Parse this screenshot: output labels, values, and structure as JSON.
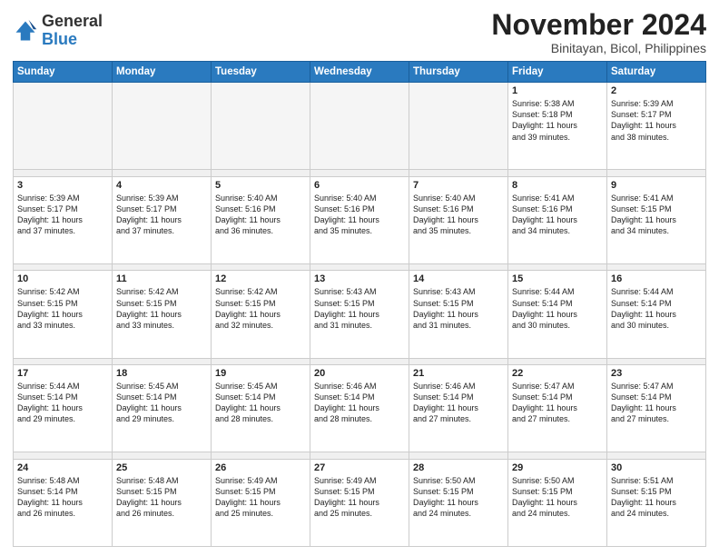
{
  "header": {
    "logo_general": "General",
    "logo_blue": "Blue",
    "month_title": "November 2024",
    "subtitle": "Binitayan, Bicol, Philippines"
  },
  "calendar": {
    "days_of_week": [
      "Sunday",
      "Monday",
      "Tuesday",
      "Wednesday",
      "Thursday",
      "Friday",
      "Saturday"
    ],
    "weeks": [
      {
        "days": [
          {
            "num": "",
            "content": ""
          },
          {
            "num": "",
            "content": ""
          },
          {
            "num": "",
            "content": ""
          },
          {
            "num": "",
            "content": ""
          },
          {
            "num": "",
            "content": ""
          },
          {
            "num": "1",
            "content": "Sunrise: 5:38 AM\nSunset: 5:18 PM\nDaylight: 11 hours and 39 minutes."
          },
          {
            "num": "2",
            "content": "Sunrise: 5:39 AM\nSunset: 5:17 PM\nDaylight: 11 hours and 38 minutes."
          }
        ]
      },
      {
        "days": [
          {
            "num": "3",
            "content": "Sunrise: 5:39 AM\nSunset: 5:17 PM\nDaylight: 11 hours and 37 minutes."
          },
          {
            "num": "4",
            "content": "Sunrise: 5:39 AM\nSunset: 5:17 PM\nDaylight: 11 hours and 37 minutes."
          },
          {
            "num": "5",
            "content": "Sunrise: 5:40 AM\nSunset: 5:16 PM\nDaylight: 11 hours and 36 minutes."
          },
          {
            "num": "6",
            "content": "Sunrise: 5:40 AM\nSunset: 5:16 PM\nDaylight: 11 hours and 35 minutes."
          },
          {
            "num": "7",
            "content": "Sunrise: 5:40 AM\nSunset: 5:16 PM\nDaylight: 11 hours and 35 minutes."
          },
          {
            "num": "8",
            "content": "Sunrise: 5:41 AM\nSunset: 5:16 PM\nDaylight: 11 hours and 34 minutes."
          },
          {
            "num": "9",
            "content": "Sunrise: 5:41 AM\nSunset: 5:15 PM\nDaylight: 11 hours and 34 minutes."
          }
        ]
      },
      {
        "days": [
          {
            "num": "10",
            "content": "Sunrise: 5:42 AM\nSunset: 5:15 PM\nDaylight: 11 hours and 33 minutes."
          },
          {
            "num": "11",
            "content": "Sunrise: 5:42 AM\nSunset: 5:15 PM\nDaylight: 11 hours and 33 minutes."
          },
          {
            "num": "12",
            "content": "Sunrise: 5:42 AM\nSunset: 5:15 PM\nDaylight: 11 hours and 32 minutes."
          },
          {
            "num": "13",
            "content": "Sunrise: 5:43 AM\nSunset: 5:15 PM\nDaylight: 11 hours and 31 minutes."
          },
          {
            "num": "14",
            "content": "Sunrise: 5:43 AM\nSunset: 5:15 PM\nDaylight: 11 hours and 31 minutes."
          },
          {
            "num": "15",
            "content": "Sunrise: 5:44 AM\nSunset: 5:14 PM\nDaylight: 11 hours and 30 minutes."
          },
          {
            "num": "16",
            "content": "Sunrise: 5:44 AM\nSunset: 5:14 PM\nDaylight: 11 hours and 30 minutes."
          }
        ]
      },
      {
        "days": [
          {
            "num": "17",
            "content": "Sunrise: 5:44 AM\nSunset: 5:14 PM\nDaylight: 11 hours and 29 minutes."
          },
          {
            "num": "18",
            "content": "Sunrise: 5:45 AM\nSunset: 5:14 PM\nDaylight: 11 hours and 29 minutes."
          },
          {
            "num": "19",
            "content": "Sunrise: 5:45 AM\nSunset: 5:14 PM\nDaylight: 11 hours and 28 minutes."
          },
          {
            "num": "20",
            "content": "Sunrise: 5:46 AM\nSunset: 5:14 PM\nDaylight: 11 hours and 28 minutes."
          },
          {
            "num": "21",
            "content": "Sunrise: 5:46 AM\nSunset: 5:14 PM\nDaylight: 11 hours and 27 minutes."
          },
          {
            "num": "22",
            "content": "Sunrise: 5:47 AM\nSunset: 5:14 PM\nDaylight: 11 hours and 27 minutes."
          },
          {
            "num": "23",
            "content": "Sunrise: 5:47 AM\nSunset: 5:14 PM\nDaylight: 11 hours and 27 minutes."
          }
        ]
      },
      {
        "days": [
          {
            "num": "24",
            "content": "Sunrise: 5:48 AM\nSunset: 5:14 PM\nDaylight: 11 hours and 26 minutes."
          },
          {
            "num": "25",
            "content": "Sunrise: 5:48 AM\nSunset: 5:15 PM\nDaylight: 11 hours and 26 minutes."
          },
          {
            "num": "26",
            "content": "Sunrise: 5:49 AM\nSunset: 5:15 PM\nDaylight: 11 hours and 25 minutes."
          },
          {
            "num": "27",
            "content": "Sunrise: 5:49 AM\nSunset: 5:15 PM\nDaylight: 11 hours and 25 minutes."
          },
          {
            "num": "28",
            "content": "Sunrise: 5:50 AM\nSunset: 5:15 PM\nDaylight: 11 hours and 24 minutes."
          },
          {
            "num": "29",
            "content": "Sunrise: 5:50 AM\nSunset: 5:15 PM\nDaylight: 11 hours and 24 minutes."
          },
          {
            "num": "30",
            "content": "Sunrise: 5:51 AM\nSunset: 5:15 PM\nDaylight: 11 hours and 24 minutes."
          }
        ]
      }
    ]
  }
}
